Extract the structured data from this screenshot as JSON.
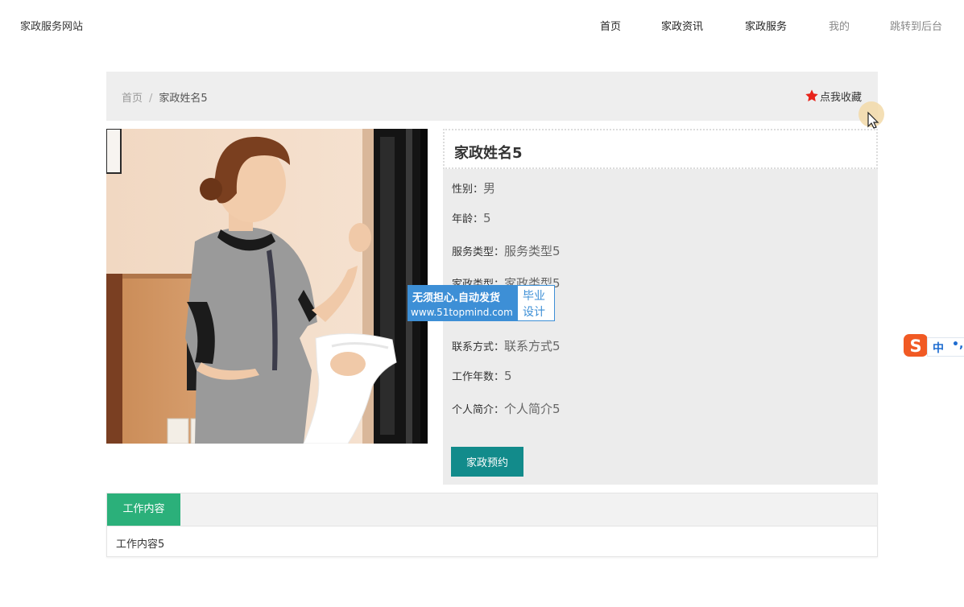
{
  "header": {
    "site_title": "家政服务网站",
    "nav": [
      {
        "label": "首页",
        "style": "dark"
      },
      {
        "label": "家政资讯",
        "style": "dark"
      },
      {
        "label": "家政服务",
        "style": "dark"
      },
      {
        "label": "我的",
        "style": "light"
      },
      {
        "label": "跳转到后台",
        "style": "light"
      }
    ]
  },
  "breadcrumb": {
    "home": "首页",
    "separator": "/",
    "current": "家政姓名5"
  },
  "favorite": {
    "label": "点我收藏",
    "icon": "star-icon",
    "icon_color": "#e8231a"
  },
  "photo": {
    "icon": "housekeeper-photo"
  },
  "detail": {
    "name": "家政姓名5",
    "fields": [
      {
        "key": "性别：",
        "value": "男"
      },
      {
        "key": "年龄：",
        "value": "5"
      },
      {
        "key": "服务类型：",
        "value": "服务类型5"
      },
      {
        "key": "家政类型：",
        "value": "家政类型5"
      },
      {
        "key": "联系方式：",
        "value": "联系方式5"
      },
      {
        "key": "工作年数：",
        "value": "5"
      },
      {
        "key": "个人简介：",
        "value": "个人简介5"
      }
    ],
    "book_button": "家政预约",
    "button_color": "#128b8b"
  },
  "tabs": {
    "active_label": "工作内容",
    "active_color": "#2bb07a",
    "content": "工作内容5"
  },
  "watermark": {
    "line1": "无须担心.自动发货",
    "line2": "www.51topmind.com",
    "right1": "毕业",
    "right2": "设计",
    "color": "#3d8fd6"
  },
  "ime": {
    "logo_icon": "sogou-ime-icon",
    "mode": "中",
    "punct": "•,"
  }
}
